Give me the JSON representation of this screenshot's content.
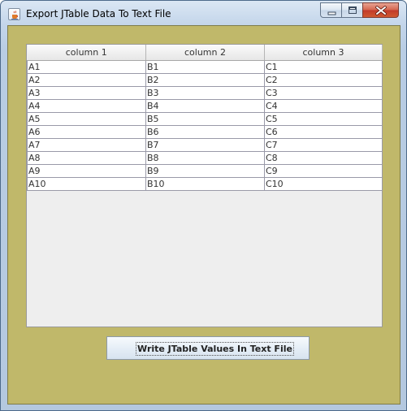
{
  "window": {
    "title": "Export JTable Data To Text File",
    "icon": "java-cup-icon",
    "controls": [
      "minimize-icon",
      "maximize-icon",
      "close-icon"
    ]
  },
  "table": {
    "columns": [
      "column 1",
      "column 2",
      "column 3"
    ],
    "rows": [
      [
        "A1",
        "B1",
        "C1"
      ],
      [
        "A2",
        "B2",
        "C2"
      ],
      [
        "A3",
        "B3",
        "C3"
      ],
      [
        "A4",
        "B4",
        "C4"
      ],
      [
        "A5",
        "B5",
        "C5"
      ],
      [
        "A6",
        "B6",
        "C6"
      ],
      [
        "A7",
        "B7",
        "C7"
      ],
      [
        "A8",
        "B8",
        "C8"
      ],
      [
        "A9",
        "B9",
        "C9"
      ],
      [
        "A10",
        "B10",
        "C10"
      ]
    ]
  },
  "actions": {
    "write_button_label": "Write JTable Values In Text File"
  },
  "colors": {
    "panel_background": "#c0b86a",
    "table_background": "#eeeeee"
  }
}
